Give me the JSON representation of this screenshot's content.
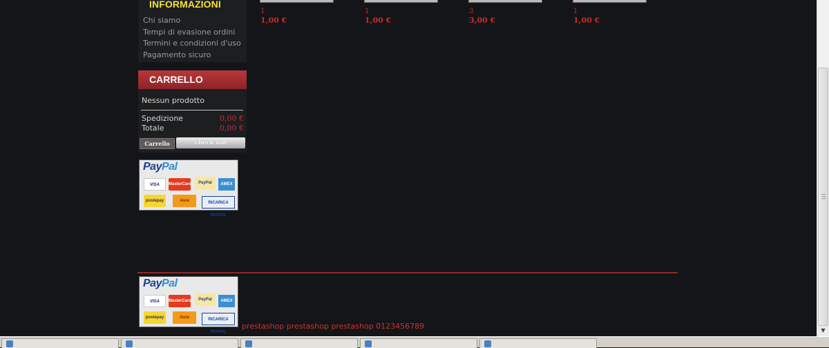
{
  "sidebar": {
    "informazioni": {
      "title": "INFORMAZIONI",
      "links": [
        "Chi siamo",
        "Tempi di evasione ordini",
        "Termini e condizioni d'uso",
        "Pagamento sicuro"
      ]
    },
    "carrello": {
      "title": "CARRELLO",
      "empty_text": "Nessun prodotto",
      "shipping_label": "Spedizione",
      "shipping_value": "0,00 €",
      "total_label": "Totale",
      "total_value": "0,00 €",
      "cart_button": "Carrello",
      "checkout_button": "check out"
    },
    "paypal": {
      "word_a": "Pay",
      "word_b": "Pal",
      "tiles": {
        "visa": "VISA",
        "mastercard": "MasterCard",
        "paypal_card": "PayPal",
        "amex": "AMEX",
        "postepay": "postepay",
        "aura": "Aura",
        "ricarica": "RICARICA PAYPAL"
      }
    }
  },
  "products": [
    {
      "qty": "1",
      "price": "1,00 €"
    },
    {
      "qty": "1",
      "price": "1,00 €"
    },
    {
      "qty": "3",
      "price": "3,00 €"
    },
    {
      "qty": "1",
      "price": "1,00 €"
    }
  ],
  "footer": {
    "text": "prestashop prestashop prestashop 0123456789"
  },
  "colors": {
    "background": "#141518",
    "accent_red": "#c62c2e",
    "title_yellow": "#f3e23a",
    "header_red": "#a8302f"
  }
}
